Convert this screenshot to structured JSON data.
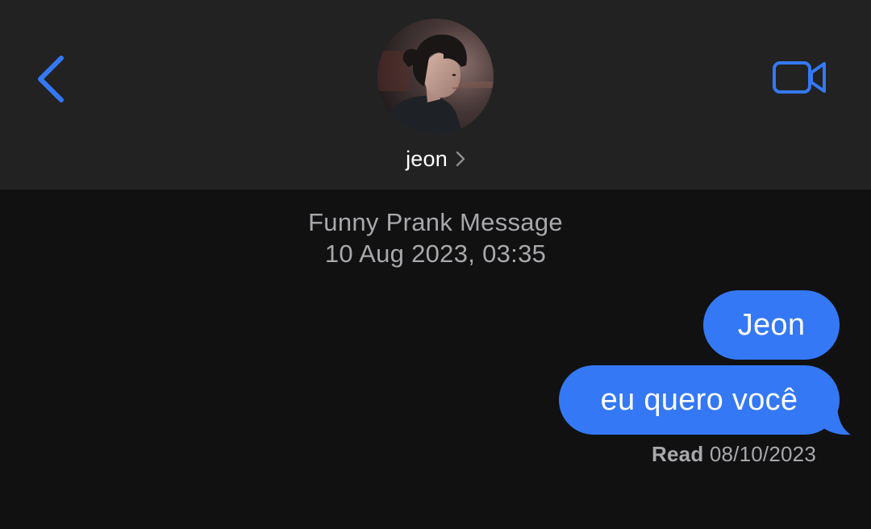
{
  "header": {
    "contact_name": "jeon",
    "back_icon": "chevron-left-icon",
    "video_icon": "video-camera-icon",
    "accent_color": "#3478f6"
  },
  "conversation": {
    "title": "Funny Prank Message",
    "datetime": "10 Aug 2023, 03:35",
    "messages": [
      {
        "text": "Jeon",
        "sender": "me"
      },
      {
        "text": "eu quero você",
        "sender": "me"
      }
    ],
    "read_receipt": {
      "label": "Read",
      "date": "08/10/2023"
    }
  }
}
